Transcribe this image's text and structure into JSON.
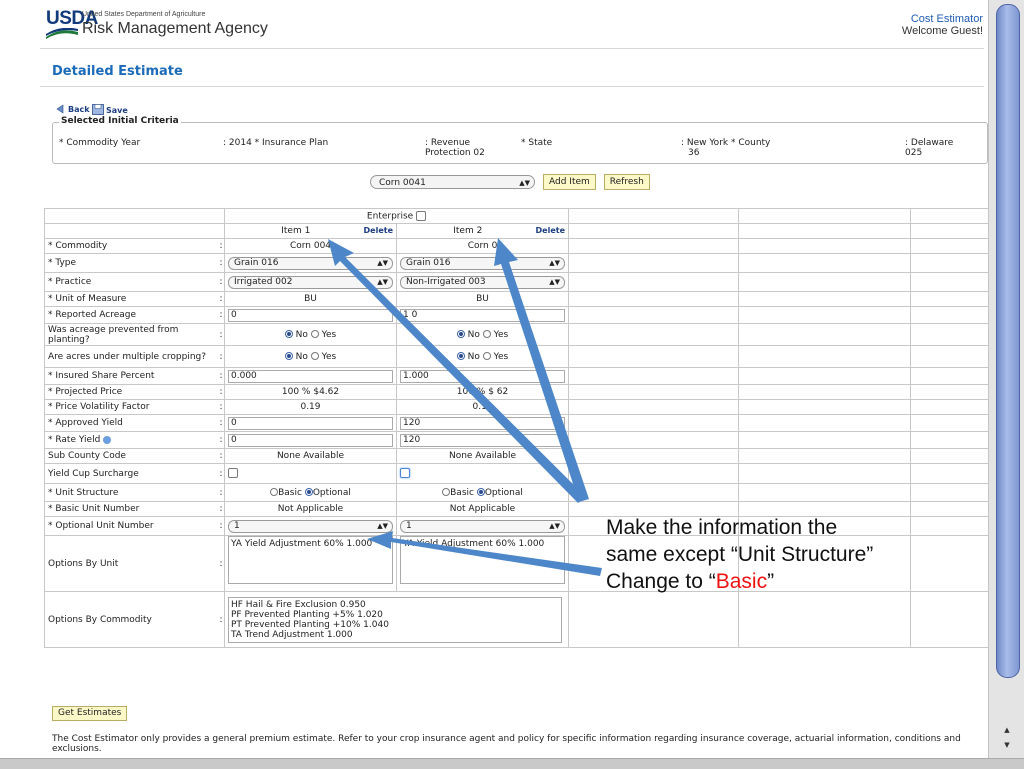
{
  "header": {
    "logo": "USDA",
    "department": "United States Department of Agriculture",
    "agency": "Risk Management Agency",
    "app_name": "Cost Estimator",
    "welcome": "Welcome Guest!"
  },
  "page_title": "Detailed Estimate",
  "toolbar": {
    "back_label": "Back",
    "save_label": "Save"
  },
  "criteria": {
    "legend": "Selected Initial Criteria",
    "commodity_year_label": "* Commodity Year",
    "commodity_year_value": ": 2014 * Insurance Plan",
    "insurance_plan_value": ": Revenue\nProtection 02",
    "state_label": "* State",
    "state_value": ": New York  * County",
    "state_code": "36",
    "county_value": ": Delaware\n025"
  },
  "controls": {
    "commodity_select": "Corn 0041",
    "add_item": "Add Item",
    "refresh": "Refresh"
  },
  "grid": {
    "enterprise_label": "Enterprise",
    "item1": "Item 1",
    "item2": "Item 2",
    "delete": "Delete",
    "rows": {
      "commodity": "* Commodity",
      "type": "* Type",
      "practice": "* Practice",
      "unit": "* Unit of Measure",
      "acreage": "* Reported Acreage",
      "prevented": "Was acreage prevented from planting?",
      "multiple": "Are acres under multiple cropping?",
      "share": "* Insured Share Percent",
      "price": "* Projected Price",
      "volatility": "* Price Volatility Factor",
      "approved": "* Approved Yield",
      "rate": "* Rate Yield",
      "subcounty": "Sub County Code",
      "yieldcup": "Yield Cup Surcharge",
      "unitstructure": "* Unit Structure",
      "basicunit": "* Basic Unit Number",
      "optionalunit": "* Optional Unit Number",
      "optionsunit": "Options By Unit",
      "optionscommodity": "Options By Commodity"
    },
    "colon": ":",
    "no": "No",
    "yes": "Yes",
    "basic": "Basic",
    "optional": "Optional",
    "i1": {
      "commodity": "Corn 004",
      "type": "Grain 016",
      "practice": "Irrigated 002",
      "unit": "BU",
      "acreage": "0",
      "share": "0.000",
      "price": "100 % $4.62",
      "volatility": "0.19",
      "approved": "0",
      "rate": "0",
      "subcounty": "None Available",
      "basicunit": "Not Applicable",
      "optionalunit": "1",
      "options": "YA Yield Adjustment 60% 1.000"
    },
    "i2": {
      "commodity": "Corn 0",
      "type": "Grain 016",
      "practice": "Non-Irrigated 003",
      "unit": "BU",
      "acreage": "1  0",
      "share": "1.000",
      "price": "100 % $  62",
      "volatility": "0.19",
      "approved": "120",
      "rate": "120",
      "subcounty": "None Available",
      "basicunit": "Not Applicable",
      "optionalunit": "1",
      "options": "YA Yield Adjustment 60% 1.000"
    },
    "commodity_options": [
      "HF Hail & Fire Exclusion 0.950",
      "PF Prevented Planting +5% 1.020",
      "PT Prevented Planting +10% 1.040",
      "TA Trend Adjustment 1.000"
    ]
  },
  "get_estimates": "Get Estimates",
  "disclaimer": "The Cost Estimator only provides a general premium estimate. Refer to your crop insurance agent and policy for specific information regarding insurance coverage, actuarial information, conditions and exclusions.",
  "callout": {
    "line1": "Make the information the",
    "line2": "same except “Unit Structure”",
    "line3_pre": "Change to “",
    "line3_red": "Basic",
    "line3_post": "”"
  },
  "colors": {
    "arrow": "#4d87c9",
    "title": "#1b6bb8",
    "button_bg": "#fdf8c8",
    "callout_red": "#e11111"
  }
}
